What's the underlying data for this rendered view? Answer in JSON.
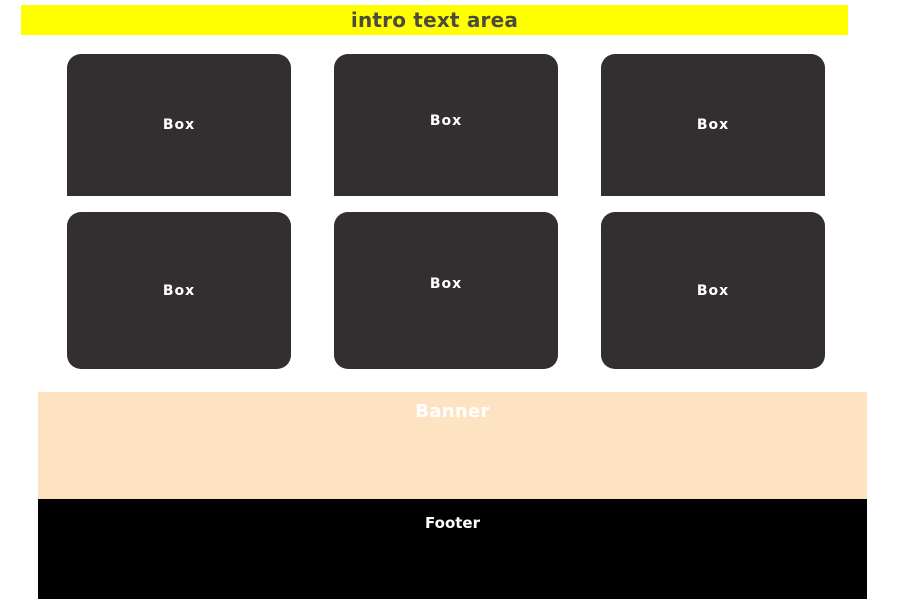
{
  "intro": {
    "text": "intro text area",
    "background": "#ffff00",
    "text_color": "#4b4b3f"
  },
  "boxes": [
    {
      "label": "Box"
    },
    {
      "label": "Box"
    },
    {
      "label": "Box"
    },
    {
      "label": "Box"
    },
    {
      "label": "Box"
    },
    {
      "label": "Box"
    }
  ],
  "box_color": "#332e2f",
  "banner": {
    "title": "Banner",
    "background": "#fde3c2"
  },
  "footer": {
    "title": "Footer",
    "background": "#000000"
  }
}
